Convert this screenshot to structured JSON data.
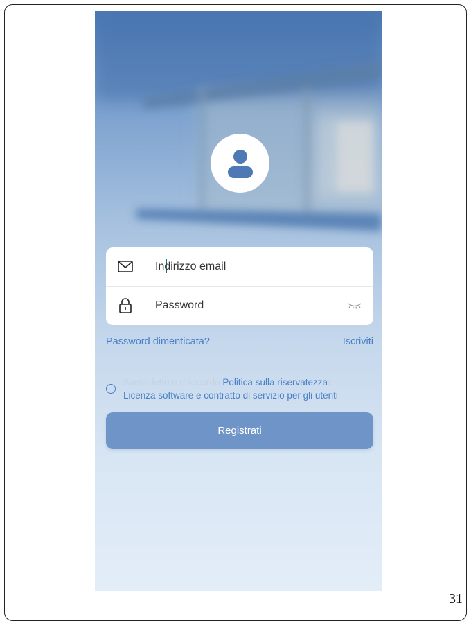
{
  "login": {
    "email_placeholder": "Indirizzo email",
    "password_placeholder": "Password"
  },
  "links": {
    "forgot_password": "Password dimenticata?",
    "register": "Iscriviti"
  },
  "agreement": {
    "prefix": "Avevo letto e d'accordo ",
    "privacy_policy": "Politica sulla riservatezza",
    "conjunction": "e",
    "license": "Licenza software e contratto di servizio per gli utenti"
  },
  "submit_label": "Registrati",
  "page_number": "31",
  "icons": {
    "avatar": "user-avatar-icon",
    "email": "envelope-icon",
    "password": "lock-icon",
    "visibility": "eye-closed-icon"
  },
  "colors": {
    "accent": "#4a80c6",
    "button": "#6f94c8",
    "caret": "#1f6f6a"
  }
}
